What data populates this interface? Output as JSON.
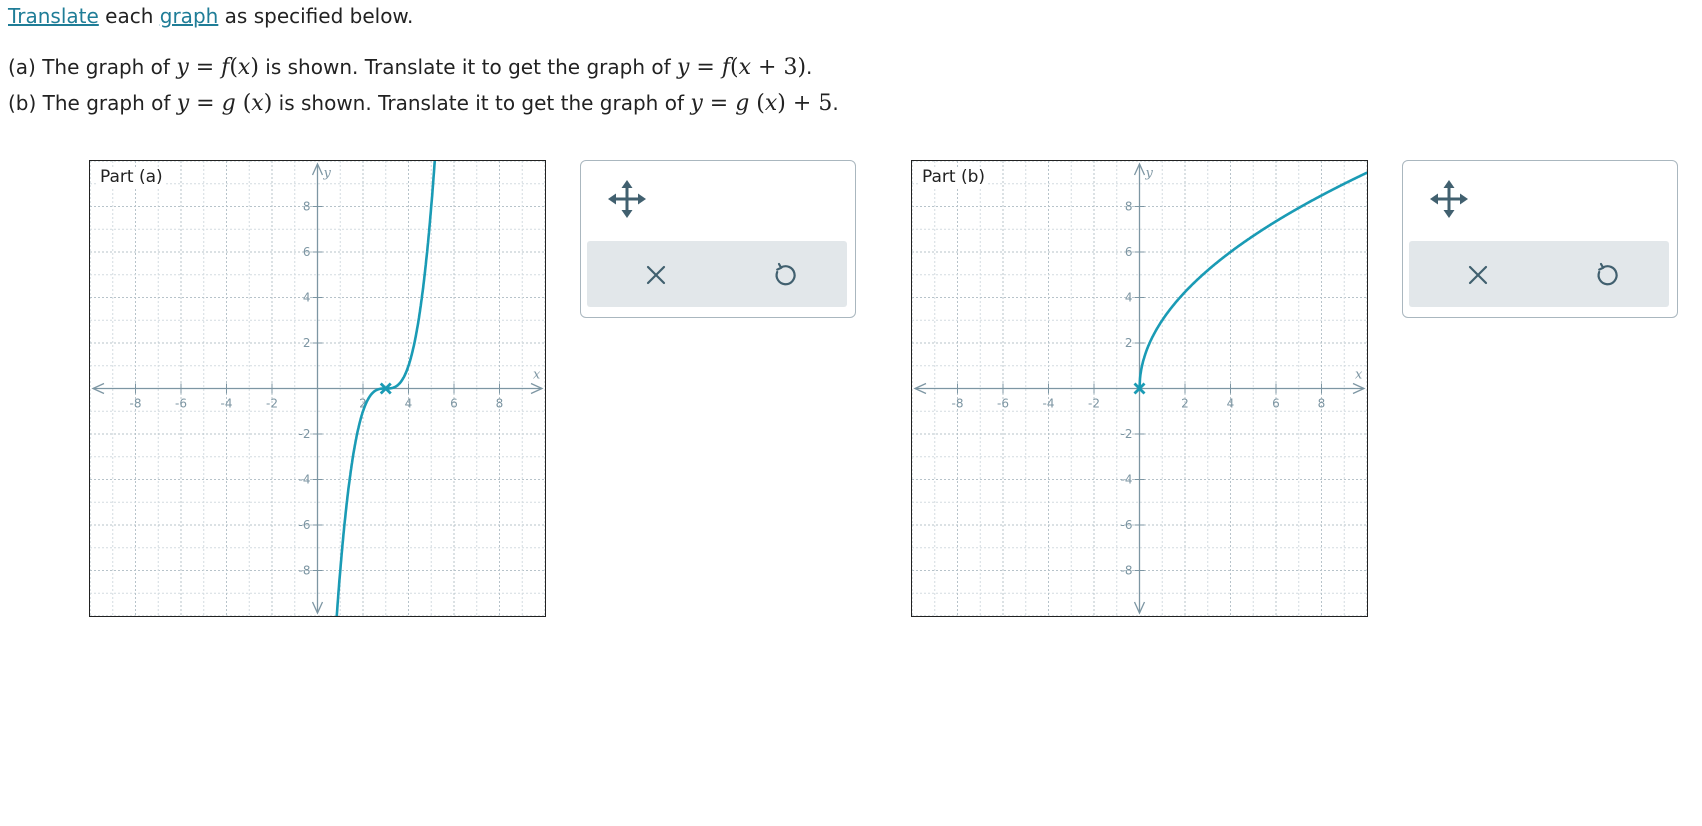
{
  "intro": {
    "link1": "Translate",
    "mid": " each ",
    "link2": "graph",
    "tail": " as specified below."
  },
  "problems": [
    {
      "prefix": "(a) The graph of ",
      "given": {
        "y": "y",
        "eq": " = ",
        "f": "f",
        "lp": "(",
        "x": "x",
        "rp": ")"
      },
      "middle": " is shown. Translate it to get the graph of ",
      "target": {
        "y": "y",
        "eq": " = ",
        "f": "f",
        "lp": "(",
        "x": "x",
        "plus": " + ",
        "num": "3",
        "rp": ")"
      },
      "end": "."
    },
    {
      "prefix": "(b) The graph of ",
      "given": {
        "y": "y",
        "eq": " = ",
        "f": "g",
        "lp": " (",
        "x": "x",
        "rp": ")"
      },
      "middle": " is shown. Translate it to get the graph of ",
      "target": {
        "y": "y",
        "eq": " = ",
        "f": "g",
        "lp": " (",
        "x": "x",
        "rp": ")",
        "plus": " + ",
        "num": "5"
      },
      "end": "."
    }
  ],
  "graphs": [
    {
      "label": "Part (a)",
      "x_axis": "x",
      "y_axis": "y",
      "x_ticks": [
        "-8",
        "-6",
        "-4",
        "-2",
        "2",
        "4",
        "6",
        "8"
      ],
      "y_ticks": [
        "8",
        "6",
        "4",
        "2",
        "-2",
        "-4",
        "-6",
        "-8"
      ],
      "range": [
        -10,
        10
      ],
      "curve": "cubic through (3,0): y = (x - 3)^3",
      "point": [
        3,
        0
      ],
      "color": "#1a9bb5"
    },
    {
      "label": "Part (b)",
      "x_axis": "x",
      "y_axis": "y",
      "x_ticks": [
        "-8",
        "-6",
        "-4",
        "-2",
        "2",
        "4",
        "6",
        "8"
      ],
      "y_ticks": [
        "8",
        "6",
        "4",
        "2",
        "-2",
        "-4",
        "-6",
        "-8"
      ],
      "range": [
        -10,
        10
      ],
      "curve": "square root from (0,0): y = 3*sqrt(x)",
      "point": [
        0,
        0
      ],
      "color": "#1a9bb5"
    }
  ],
  "tools": {
    "move_icon": "move-arrows-icon",
    "clear_icon": "close-icon",
    "undo_icon": "undo-icon"
  }
}
